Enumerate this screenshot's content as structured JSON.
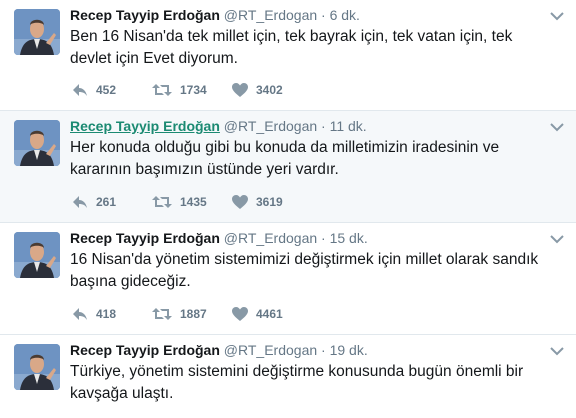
{
  "tweets": [
    {
      "name": "Recep Tayyip Erdoğan",
      "handle": "@RT_Erdogan",
      "dot": "·",
      "time": "6 dk.",
      "text": "Ben 16 Nisan'da tek millet için, tek bayrak için, tek vatan için, tek devlet için Evet diyorum.",
      "replies": "452",
      "retweets": "1734",
      "likes": "3402"
    },
    {
      "name": "Recep Tayyip Erdoğan",
      "handle": "@RT_Erdogan",
      "dot": "·",
      "time": "11 dk.",
      "text": "Her konuda olduğu gibi bu konuda da milletimizin iradesinin ve kararının başımızın üstünde yeri vardır.",
      "replies": "261",
      "retweets": "1435",
      "likes": "3619"
    },
    {
      "name": "Recep Tayyip Erdoğan",
      "handle": "@RT_Erdogan",
      "dot": "·",
      "time": "15 dk.",
      "text": "16 Nisan'da yönetim sistemimizi değiştirmek için millet olarak sandık başına gideceğiz.",
      "replies": "418",
      "retweets": "1887",
      "likes": "4461"
    },
    {
      "name": "Recep Tayyip Erdoğan",
      "handle": "@RT_Erdogan",
      "dot": "·",
      "time": "19 dk.",
      "text": "Türkiye, yönetim sistemini değiştirme konusunda bugün önemli bir kavşağa ulaştı.",
      "replies": "",
      "retweets": "",
      "likes": ""
    }
  ],
  "colors": {
    "text": "#14171a",
    "muted": "#657786",
    "hover_background": "#f5f8fa",
    "hover_name": "#1b8a72",
    "divider": "#e1e8ed"
  },
  "icons": [
    "avatar",
    "chevron-down-icon",
    "reply-icon",
    "retweet-icon",
    "heart-icon"
  ]
}
